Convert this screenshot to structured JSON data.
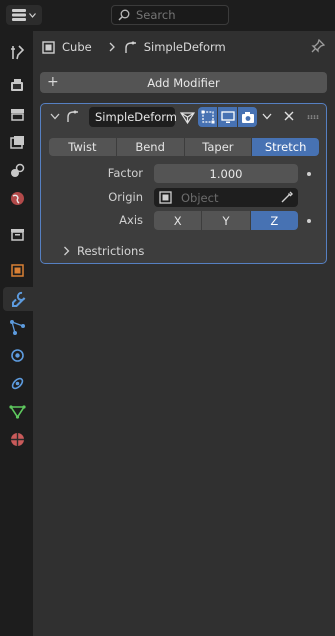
{
  "header": {
    "search_placeholder": "Search"
  },
  "breadcrumb": {
    "object": "Cube",
    "modifier": "SimpleDeform"
  },
  "add_modifier_label": "Add Modifier",
  "modifier": {
    "name": "SimpleDeform",
    "modes": [
      "Twist",
      "Bend",
      "Taper",
      "Stretch"
    ],
    "active_mode": "Stretch",
    "factor_label": "Factor",
    "factor_value": "1.000",
    "origin_label": "Origin",
    "origin_placeholder": "Object",
    "axis_label": "Axis",
    "axes": [
      "X",
      "Y",
      "Z"
    ],
    "active_axis": "Z",
    "restrictions_label": "Restrictions"
  },
  "colors": {
    "accent": "#4772b3",
    "panel_outline": "#5680c2"
  },
  "tabs": [
    "tool-icon",
    "render-icon",
    "output-icon",
    "view-layer-icon",
    "scene-icon",
    "world-icon",
    "collection-icon",
    "object-icon",
    "modifier-icon",
    "particles-icon",
    "physics-icon",
    "constraints-icon",
    "data-icon",
    "material-icon"
  ],
  "active_tab": "modifier-icon"
}
